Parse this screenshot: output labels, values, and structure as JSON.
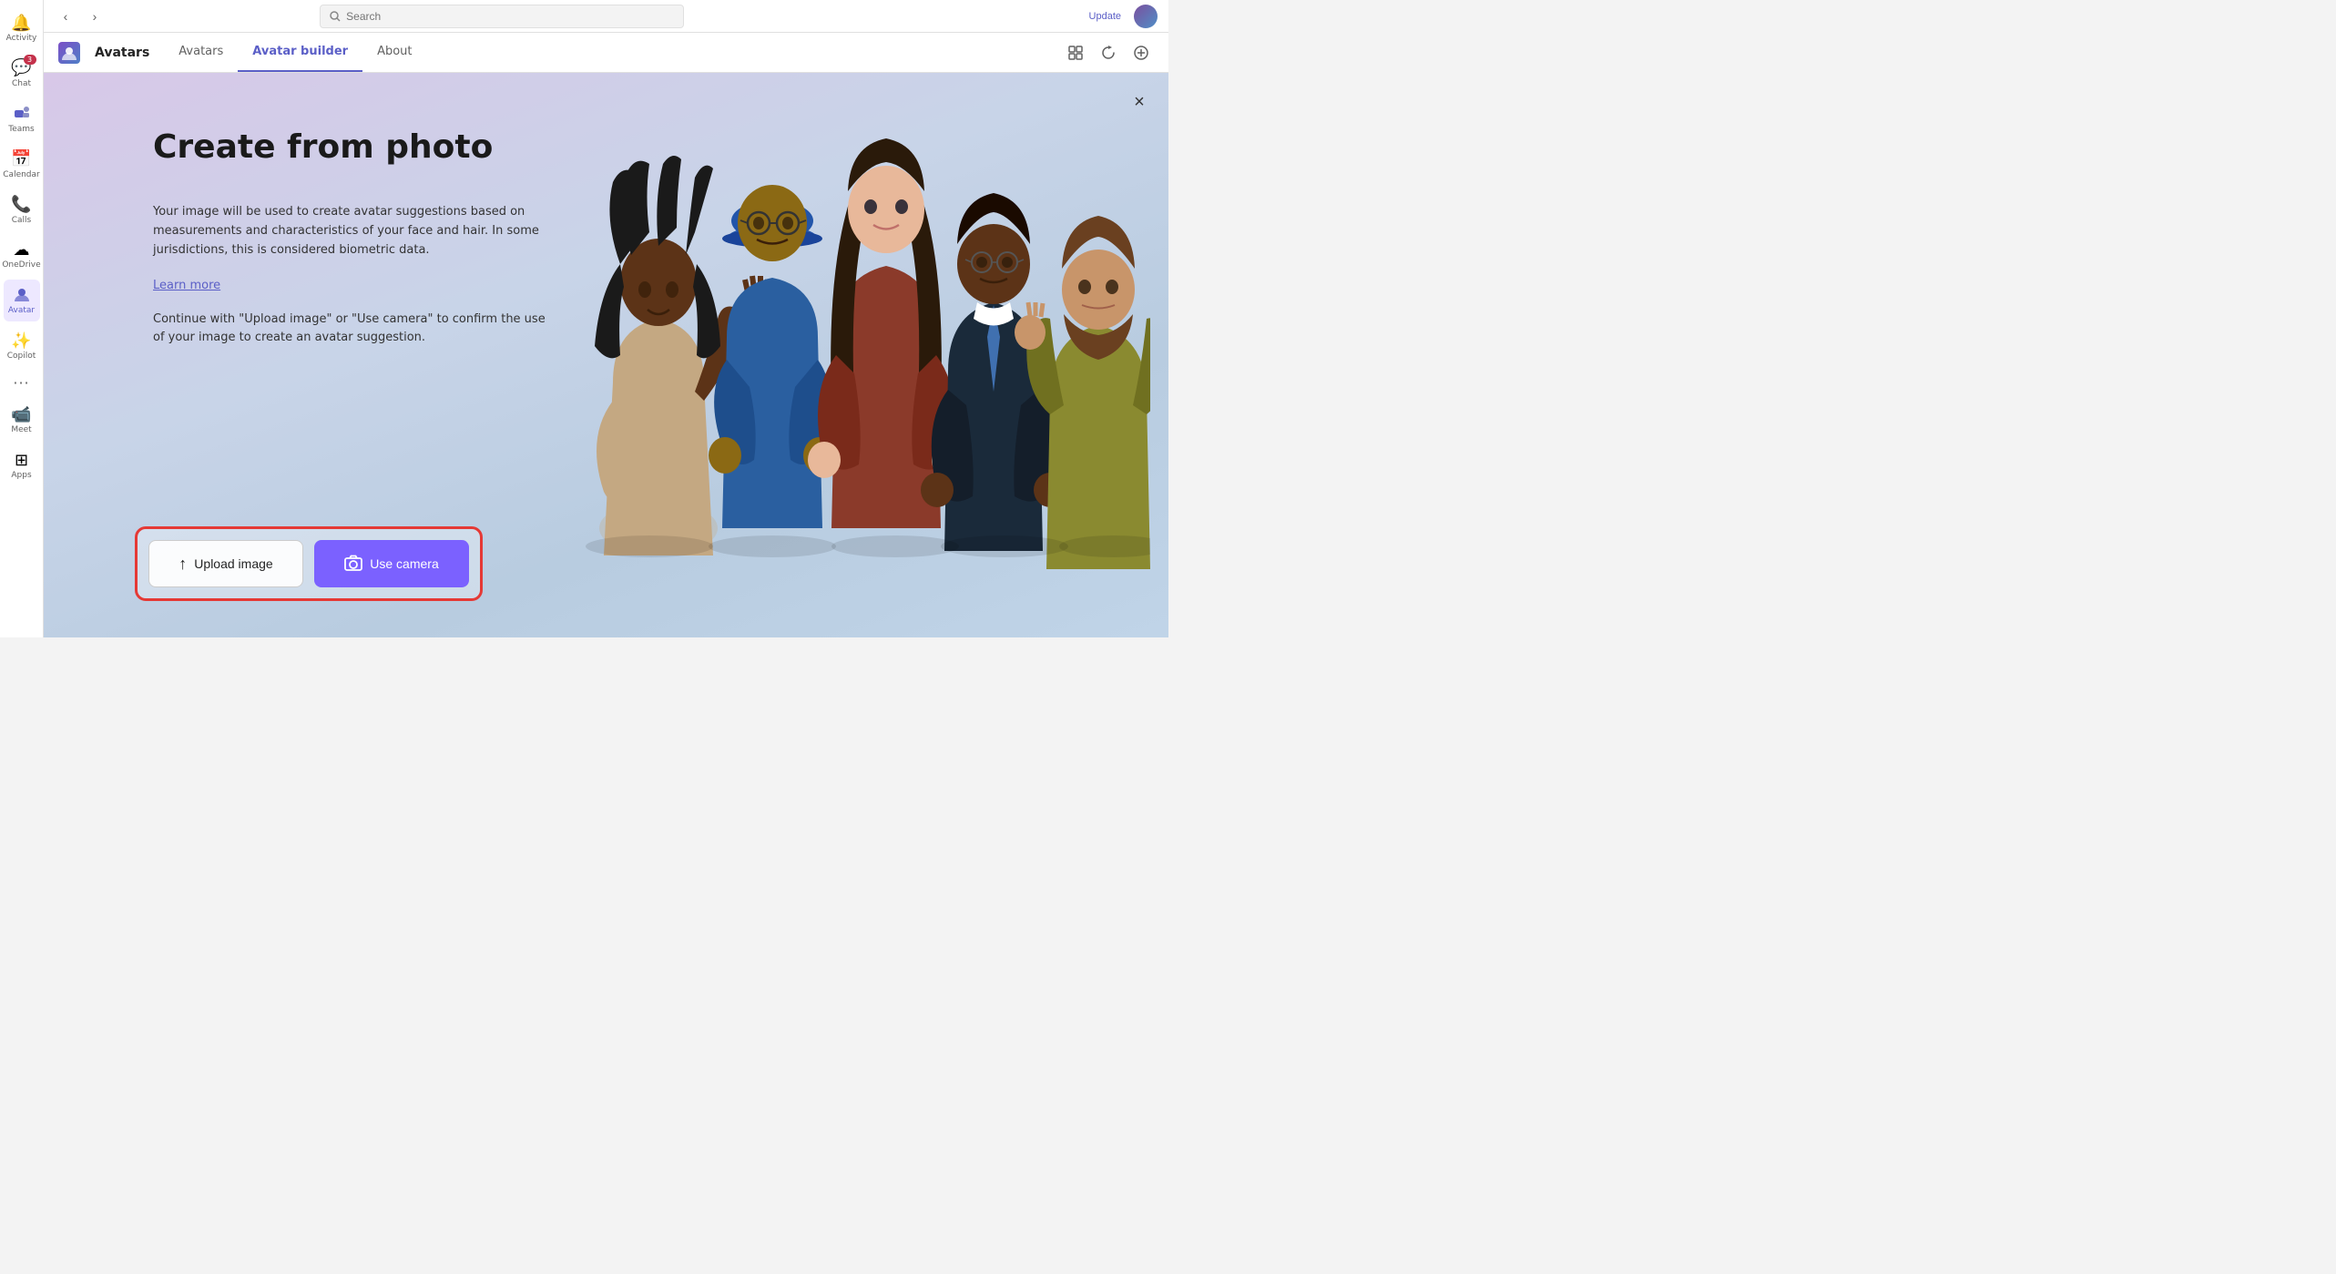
{
  "app": {
    "title": "Avatars",
    "tabs": [
      {
        "id": "avatars",
        "label": "Avatars",
        "active": false
      },
      {
        "id": "avatar-builder",
        "label": "Avatar builder",
        "active": true
      },
      {
        "id": "about",
        "label": "About",
        "active": false
      }
    ]
  },
  "titlebar": {
    "search_placeholder": "Search",
    "update_label": "Update",
    "nav_back": "‹",
    "nav_forward": "›"
  },
  "sidebar": {
    "items": [
      {
        "id": "activity",
        "label": "Activity",
        "icon": "🔔",
        "badge": ""
      },
      {
        "id": "chat",
        "label": "Chat",
        "icon": "💬",
        "badge": "3"
      },
      {
        "id": "teams",
        "label": "Teams",
        "icon": "👥",
        "badge": ""
      },
      {
        "id": "calendar",
        "label": "Calendar",
        "icon": "📅",
        "badge": ""
      },
      {
        "id": "calls",
        "label": "Calls",
        "icon": "📞",
        "badge": ""
      },
      {
        "id": "onedrive",
        "label": "OneDrive",
        "icon": "☁",
        "badge": ""
      },
      {
        "id": "avatar",
        "label": "Avatar",
        "icon": "👤",
        "badge": "",
        "active": true
      },
      {
        "id": "copilot",
        "label": "Copilot",
        "icon": "✨",
        "badge": ""
      },
      {
        "id": "meet",
        "label": "Meet",
        "icon": "📹",
        "badge": ""
      },
      {
        "id": "apps",
        "label": "Apps",
        "icon": "⊞",
        "badge": ""
      }
    ]
  },
  "header_icons": {
    "icon1": "⊡",
    "icon2": "↺",
    "icon3": "+"
  },
  "page": {
    "title": "Create from photo",
    "description": "Your image will be used to create avatar suggestions based on measurements and characteristics of your face and hair. In some jurisdictions, this is considered biometric data.",
    "learn_more": "Learn more",
    "confirm_text": "Continue with \"Upload image\" or \"Use camera\" to confirm the use of your image to create an avatar suggestion.",
    "close_icon": "×"
  },
  "buttons": {
    "upload_icon": "↑",
    "upload_label": "Upload image",
    "camera_icon": "📷",
    "camera_label": "Use camera"
  },
  "colors": {
    "accent": "#5b5fc7",
    "camera_btn_bg": "#7b61ff",
    "highlight_border": "#e53935"
  }
}
